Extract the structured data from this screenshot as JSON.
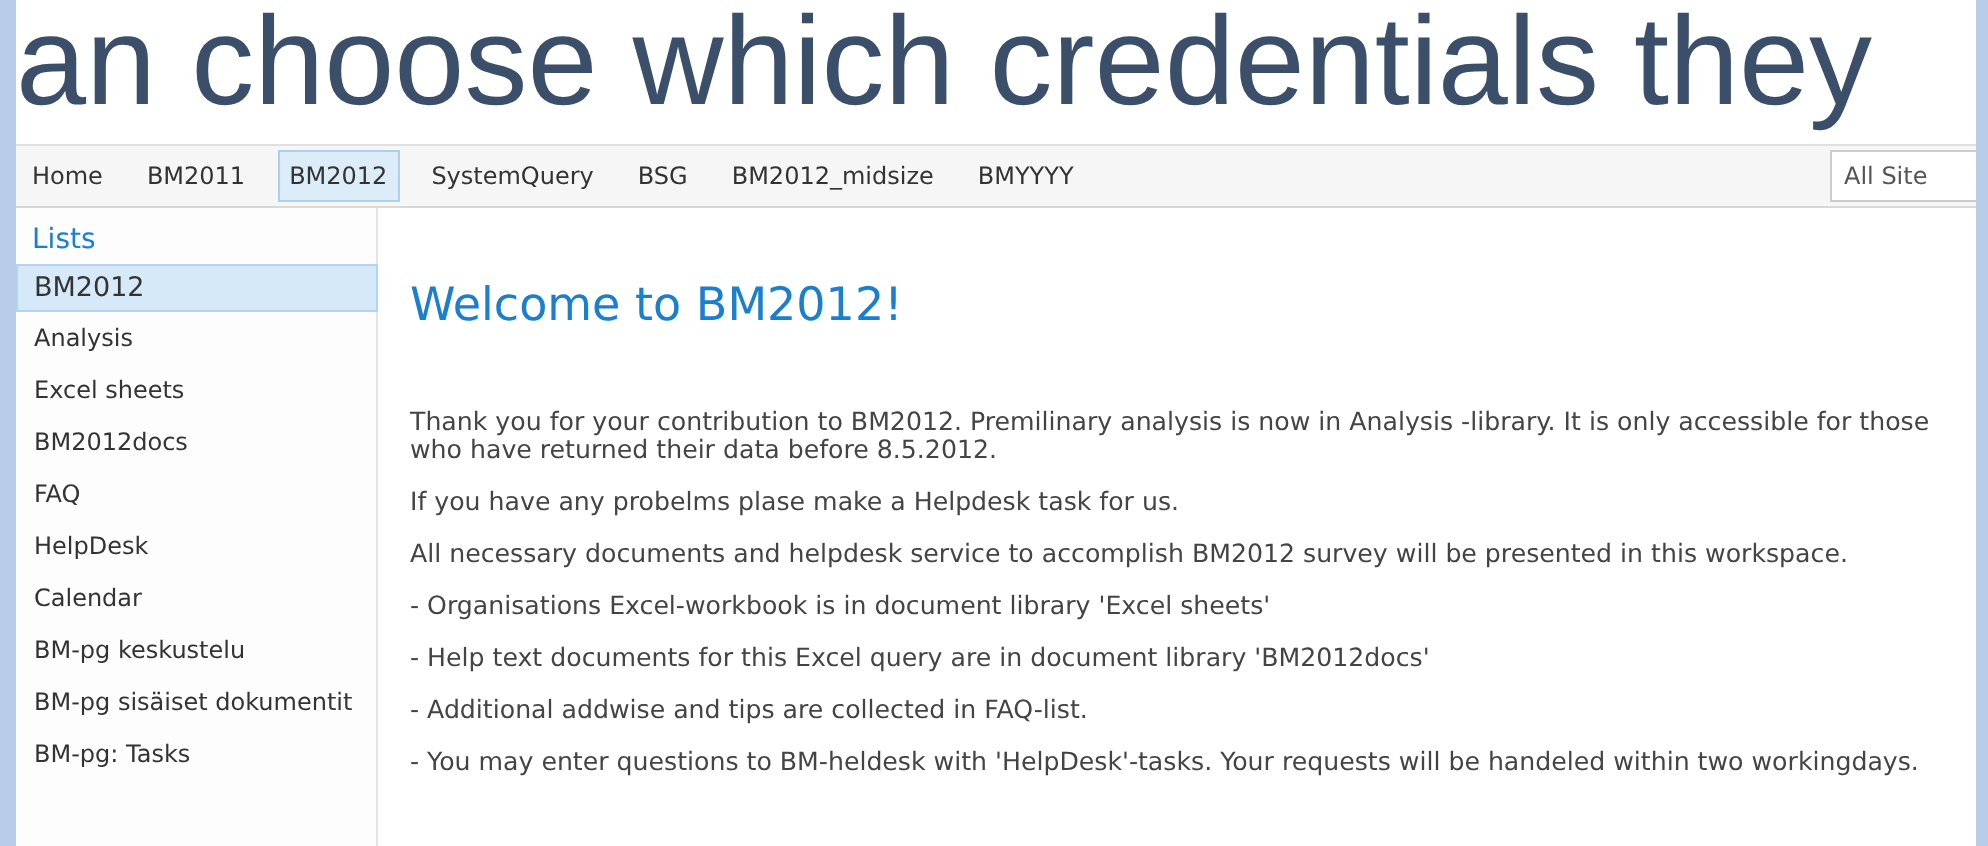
{
  "slide_caption": "an choose which credentials they",
  "top_nav": [
    {
      "label": "Home",
      "selected": false
    },
    {
      "label": "BM2011",
      "selected": false
    },
    {
      "label": "BM2012",
      "selected": true
    },
    {
      "label": "SystemQuery",
      "selected": false
    },
    {
      "label": "BSG",
      "selected": false
    },
    {
      "label": "BM2012_midsize",
      "selected": false
    },
    {
      "label": "BMYYYY",
      "selected": false
    }
  ],
  "search": {
    "placeholder": "All Site"
  },
  "sidebar": {
    "heading": "Lists",
    "items": [
      {
        "label": "BM2012",
        "selected": true
      },
      {
        "label": "Analysis",
        "selected": false
      },
      {
        "label": "Excel sheets",
        "selected": false
      },
      {
        "label": "BM2012docs",
        "selected": false
      },
      {
        "label": "FAQ",
        "selected": false
      },
      {
        "label": "HelpDesk",
        "selected": false
      },
      {
        "label": "Calendar",
        "selected": false
      },
      {
        "label": "BM-pg keskustelu",
        "selected": false
      },
      {
        "label": "BM-pg sisäiset dokumentit",
        "selected": false
      },
      {
        "label": "BM-pg: Tasks",
        "selected": false
      }
    ]
  },
  "content": {
    "title": "Welcome to BM2012!",
    "paragraphs": [
      "Thank you for your contribution to BM2012. Premilinary analysis is now in Analysis -library. It is only accessible for those who have returned their data before 8.5.2012.",
      "If you have any probelms plase make a Helpdesk task for us.",
      "All necessary documents and helpdesk service to accomplish BM2012 survey will be presented in this workspace.",
      "- Organisations Excel-workbook is in document library 'Excel sheets'",
      "- Help text documents for this Excel query are in document library 'BM2012docs'",
      "- Additional addwise and tips are collected in FAQ-list.",
      "- You may enter questions to BM-heldesk with 'HelpDesk'-tasks. Your requests will be handeled within two workingdays."
    ]
  }
}
